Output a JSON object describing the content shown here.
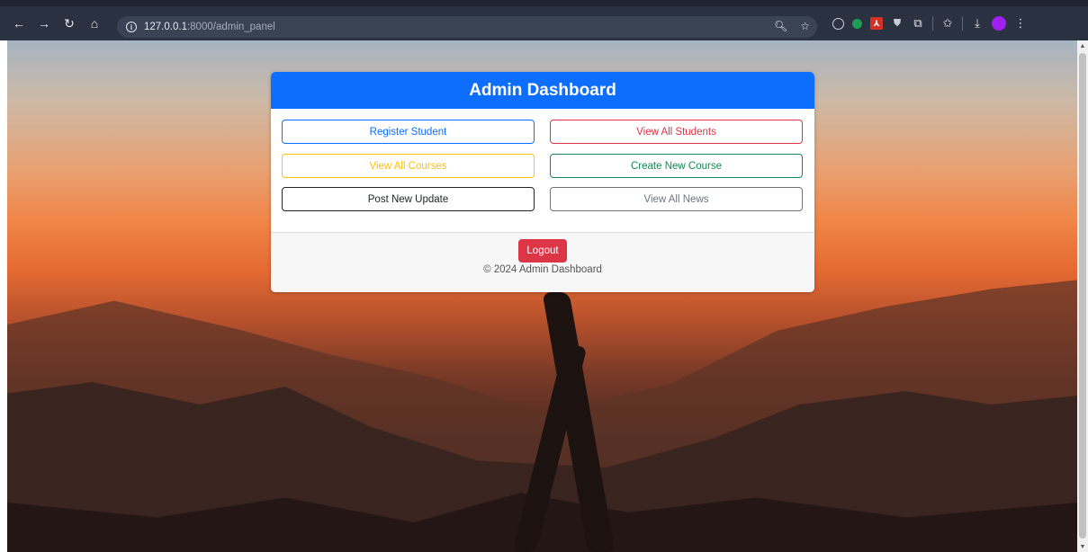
{
  "browser": {
    "url_host": "127.0.0.1",
    "url_rest": ":8000/admin_panel"
  },
  "dashboard": {
    "title": "Admin Dashboard",
    "buttons": [
      {
        "label": "Register Student",
        "color": "#0d6efd"
      },
      {
        "label": "View All Students",
        "color": "#dc3545"
      },
      {
        "label": "View All Courses",
        "color": "#ffc107"
      },
      {
        "label": "Create New Course",
        "color": "#198754"
      },
      {
        "label": "Post New Update",
        "color": "#212529"
      },
      {
        "label": "View All News",
        "color": "#6c757d"
      }
    ],
    "logout_label": "Logout",
    "copyright": "© 2024 Admin Dashboard",
    "header_color": "#0d6efd"
  },
  "icons": {
    "toolbar_left": [
      "back-arrow-icon",
      "forward-arrow-icon",
      "reload-icon",
      "home-icon"
    ],
    "omnibox": [
      "site-info-icon",
      "zoom-icon",
      "bookmark-star-icon"
    ],
    "extensions": [
      "extension-gray-icon",
      "extension-green-icon",
      "pdf-extension-icon",
      "shield-extension-icon",
      "puzzle-extensions-icon",
      "reading-list-icon",
      "download-icon",
      "profile-avatar",
      "menu-kebab-icon"
    ]
  }
}
